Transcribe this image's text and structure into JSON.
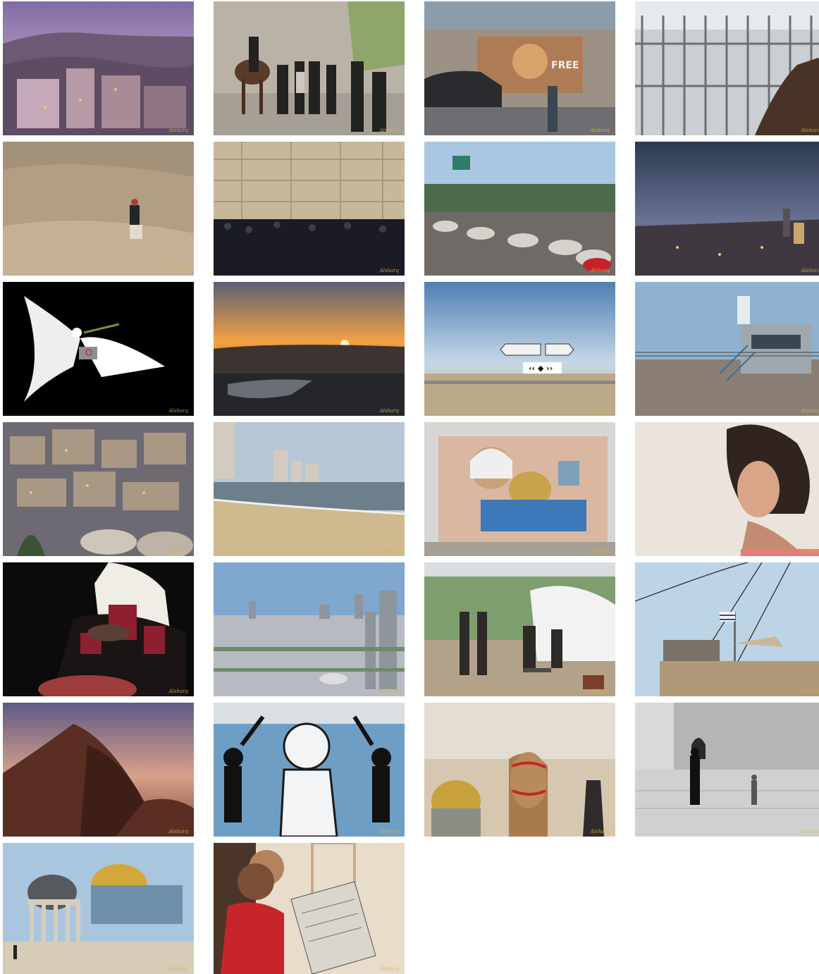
{
  "gallery": {
    "signature": "Alsharq",
    "items": [
      {
        "id": "bethlehem-dusk-cityscape",
        "subject": "Hillside city at dusk"
      },
      {
        "id": "mounted-police-arrest",
        "subject": "Police and mounted officer detaining men"
      },
      {
        "id": "free-marwan-mural",
        "subject": "Separation wall mural with car"
      },
      {
        "id": "checkpoint-turnstile",
        "subject": "Hand gripping checkpoint bars"
      },
      {
        "id": "desert-donkey-rider",
        "subject": "Rider on donkey in desert"
      },
      {
        "id": "western-wall-crowd",
        "subject": "Crowd at the stone wall"
      },
      {
        "id": "street-prayer",
        "subject": "Rows of men praying in the street"
      },
      {
        "id": "old-city-evening",
        "subject": "Old city skyline at evening"
      },
      {
        "id": "armored-dove",
        "subject": "Dove with olive branch wearing vest"
      },
      {
        "id": "dead-sea-sunset",
        "subject": "Sunset over the sea"
      },
      {
        "id": "desert-road-sign",
        "subject": "Road junction sign in desert"
      },
      {
        "id": "watchtower-fence",
        "subject": "Watchtower behind fence"
      },
      {
        "id": "silwan-night-houses",
        "subject": "Stone houses at twilight"
      },
      {
        "id": "tel-aviv-beach",
        "subject": "Beach with high-rise towers"
      },
      {
        "id": "arafat-dome-mural",
        "subject": "Mural with portrait and golden dome"
      },
      {
        "id": "woman-at-wall",
        "subject": "Woman leaning against wall"
      },
      {
        "id": "embroidery-elder",
        "subject": "Elderly woman embroidering"
      },
      {
        "id": "tel-aviv-skyline",
        "subject": "City skyline from above"
      },
      {
        "id": "tent-protest",
        "subject": "People near protest tents"
      },
      {
        "id": "flag-watchtower",
        "subject": "Guard tower with flag and wires"
      },
      {
        "id": "desert-mountain-dusk",
        "subject": "Mountain silhouette at dusk"
      },
      {
        "id": "handala-wall-art",
        "subject": "Cartoon boy graffiti on wall"
      },
      {
        "id": "camel-dome",
        "subject": "Decorated camel with golden dome behind"
      },
      {
        "id": "old-city-plaza-bw",
        "subject": "Man and child crossing plaza"
      },
      {
        "id": "dome-of-the-rock",
        "subject": "Golden dome and small cupola"
      },
      {
        "id": "boy-reading-newspaper",
        "subject": "Boy and man reading newspaper"
      }
    ]
  }
}
